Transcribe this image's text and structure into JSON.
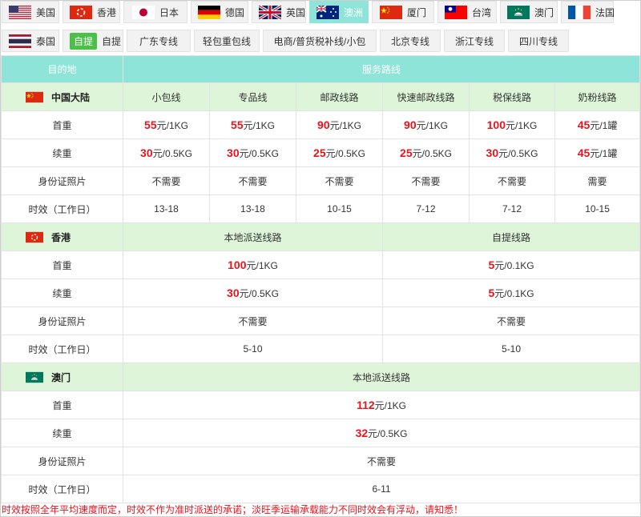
{
  "tabs_row1": [
    {
      "label": "美国",
      "flag": "us-flag-icon"
    },
    {
      "label": "香港",
      "flag": "hk-flag-icon"
    },
    {
      "label": "日本",
      "flag": "jp-flag-icon"
    },
    {
      "label": "德国",
      "flag": "de-flag-icon"
    },
    {
      "label": "英国",
      "flag": "uk-flag-icon"
    },
    {
      "label": "澳洲",
      "flag": "au-flag-icon",
      "active": true
    },
    {
      "label": "厦门",
      "flag": "cn-flag-icon"
    },
    {
      "label": "台湾",
      "flag": "tw-flag-icon"
    },
    {
      "label": "澳门",
      "flag": "mo-flag-icon"
    },
    {
      "label": "法国",
      "flag": "fr-flag-icon"
    }
  ],
  "tabs_row2": [
    {
      "label": "泰国",
      "flag": "th-flag-icon"
    },
    {
      "label": "自提",
      "badge": "自提"
    },
    {
      "label": "广东专线"
    },
    {
      "label": "轻包重包线"
    },
    {
      "label": "电商/普货税补线/小包"
    },
    {
      "label": "北京专线"
    },
    {
      "label": "浙江专线"
    },
    {
      "label": "四川专线"
    }
  ],
  "table": {
    "header": {
      "destination": "目的地",
      "service": "服务路线"
    },
    "row_labels": {
      "first": "首重",
      "extra": "续重",
      "id": "身份证照片",
      "time": "时效（工作日）"
    },
    "mainland": {
      "name": "中国大陆",
      "lines": [
        {
          "name": "小包线",
          "first": "55",
          "first_unit": "元/1KG",
          "extra": "30",
          "extra_unit": "元/0.5KG",
          "id": "不需要",
          "time": "13-18"
        },
        {
          "name": "专品线",
          "first": "55",
          "first_unit": "元/1KG",
          "extra": "30",
          "extra_unit": "元/0.5KG",
          "id": "不需要",
          "time": "13-18"
        },
        {
          "name": "邮政线路",
          "first": "90",
          "first_unit": "元/1KG",
          "extra": "25",
          "extra_unit": "元/0.5KG",
          "id": "不需要",
          "time": "10-15"
        },
        {
          "name": "快速邮政线路",
          "first": "90",
          "first_unit": "元/1KG",
          "extra": "25",
          "extra_unit": "元/0.5KG",
          "id": "不需要",
          "time": "7-12"
        },
        {
          "name": "税保线路",
          "first": "100",
          "first_unit": "元/1KG",
          "extra": "30",
          "extra_unit": "元/0.5KG",
          "id": "不需要",
          "time": "7-12"
        },
        {
          "name": "奶粉线路",
          "first": "45",
          "first_unit": "元/1罐",
          "extra": "45",
          "extra_unit": "元/1罐",
          "id": "需要",
          "time": "10-15"
        }
      ]
    },
    "hongkong": {
      "name": "香港",
      "lines": [
        {
          "name": "本地派送线路",
          "first": "100",
          "first_unit": "元/1KG",
          "extra": "30",
          "extra_unit": "元/0.5KG",
          "id": "不需要",
          "time": "5-10"
        },
        {
          "name": "自提线路",
          "first": "5",
          "first_unit": "元/0.1KG",
          "extra": "5",
          "extra_unit": "元/0.1KG",
          "id": "不需要",
          "time": "5-10"
        }
      ]
    },
    "macau": {
      "name": "澳门",
      "line": {
        "name": "本地派送线路",
        "first": "112",
        "first_unit": "元/1KG",
        "extra": "32",
        "extra_unit": "元/0.5KG",
        "id": "不需要",
        "time": "6-11"
      }
    }
  },
  "notice": "时效按照全年平均速度而定，时效不作为准时派送的承诺；淡旺季运输承载能力不同时效会有浮动，请知悉！",
  "colors": {
    "accent": "#8ee4d8",
    "region_bg": "#dff5d9",
    "price": "#e8141c",
    "badge": "#4cbf4a"
  }
}
